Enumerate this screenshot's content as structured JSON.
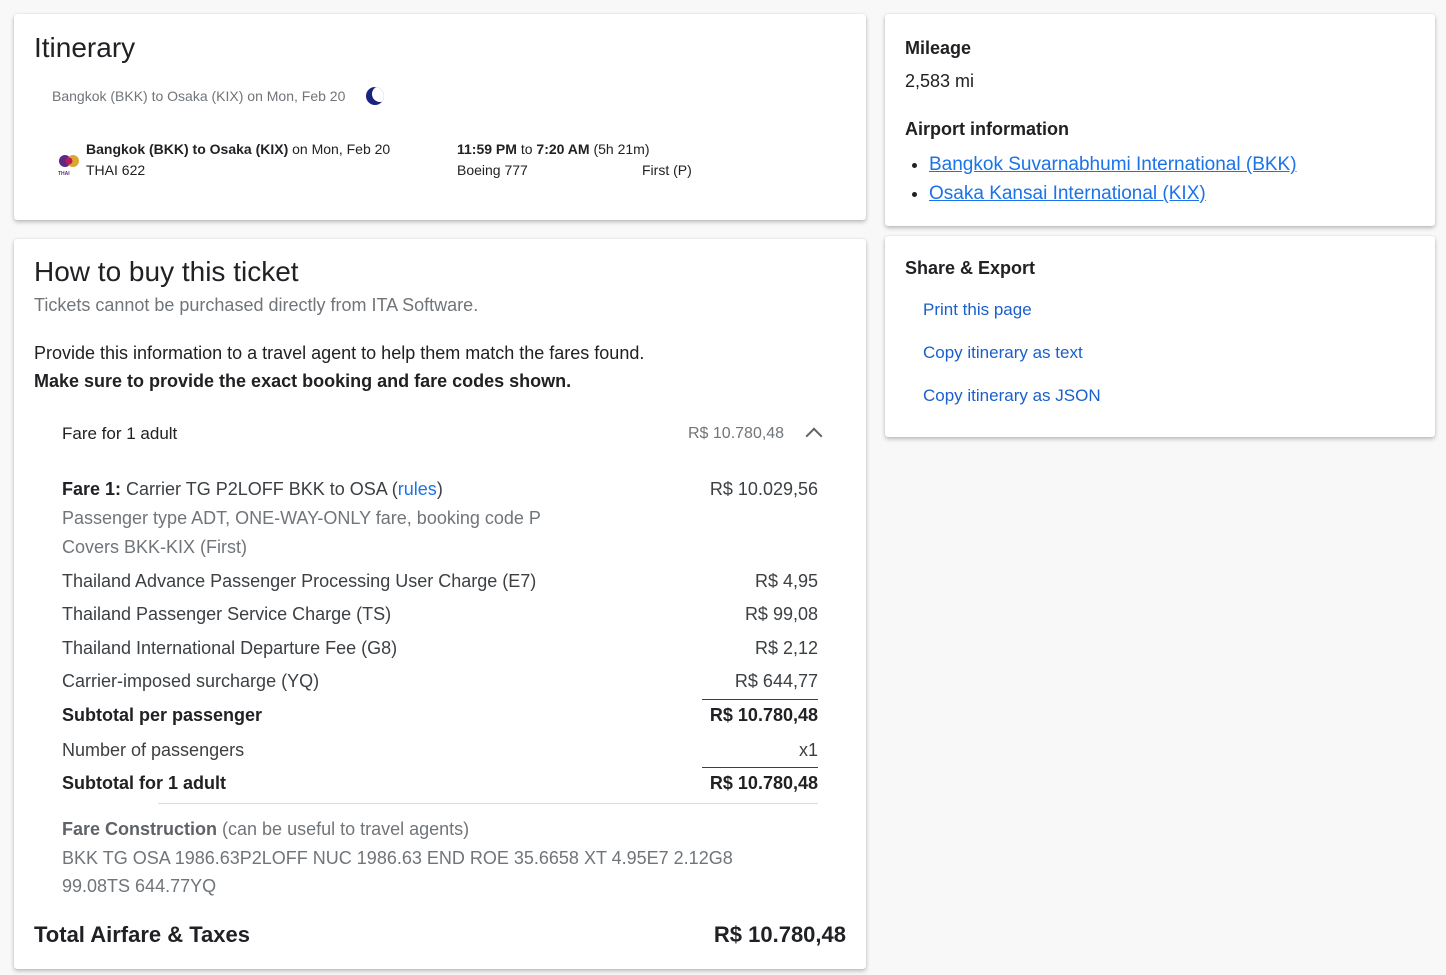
{
  "itinerary": {
    "title": "Itinerary",
    "summary": "Bangkok (BKK) to Osaka (KIX) on Mon, Feb 20",
    "segment": {
      "route": "Bangkok (BKK) to Osaka (KIX)",
      "date_prefix": "on Mon, Feb 20",
      "flight": "THAI 622",
      "depart": "11:59 PM",
      "to_word": "to",
      "arrive": "7:20 AM",
      "duration": "(5h 21m)",
      "aircraft": "Boeing 777",
      "cabin": "First (P)",
      "logo_text": "THAI"
    }
  },
  "buy": {
    "title": "How to buy this ticket",
    "notice": "Tickets cannot be purchased directly from ITA Software.",
    "instruction": "Provide this information to a travel agent to help them match the fares found.",
    "instruction_bold": "Make sure to provide the exact booking and fare codes shown.",
    "fare_header": {
      "label": "Fare for 1 adult",
      "amount": "R$ 10.780,48"
    },
    "fare1": {
      "prefix": "Fare 1:",
      "text": "Carrier TG P2LOFF BKK to OSA (",
      "rules": "rules",
      "close": ")",
      "amount": "R$ 10.029,56",
      "line2": "Passenger type ADT, ONE-WAY-ONLY fare, booking code P",
      "line3": "Covers BKK-KIX (First)"
    },
    "charges": [
      {
        "label": "Thailand Advance Passenger Processing User Charge (E7)",
        "amount": "R$ 4,95"
      },
      {
        "label": "Thailand Passenger Service Charge (TS)",
        "amount": "R$ 99,08"
      },
      {
        "label": "Thailand International Departure Fee (G8)",
        "amount": "R$ 2,12"
      },
      {
        "label": "Carrier-imposed surcharge (YQ)",
        "amount": "R$ 644,77"
      }
    ],
    "subtotal_pp": {
      "label": "Subtotal per passenger",
      "amount": "R$ 10.780,48"
    },
    "num_pass": {
      "label": "Number of passengers",
      "amount": "x1"
    },
    "subtotal_adult": {
      "label": "Subtotal for 1 adult",
      "amount": "R$ 10.780,48"
    },
    "fare_construction": {
      "label": "Fare Construction",
      "note": "(can be useful to travel agents)",
      "line1": "BKK TG OSA 1986.63P2LOFF NUC 1986.63 END ROE 35.6658 XT 4.95E7 2.12G8",
      "line2": "99.08TS 644.77YQ"
    },
    "total": {
      "label": "Total Airfare & Taxes",
      "amount": "R$ 10.780,48"
    }
  },
  "mileage": {
    "title": "Mileage",
    "value": "2,583 mi",
    "airport_title": "Airport information",
    "airports": [
      "Bangkok Suvarnabhumi International (BKK)",
      "Osaka Kansai International (KIX)"
    ]
  },
  "share": {
    "title": "Share & Export",
    "links": [
      "Print this page",
      "Copy itinerary as text",
      "Copy itinerary as JSON"
    ]
  },
  "colors": {
    "link": "#1a73e8",
    "moon": "#1a237e",
    "logo_purple": "#5b2a86",
    "logo_gold": "#d4a017"
  }
}
